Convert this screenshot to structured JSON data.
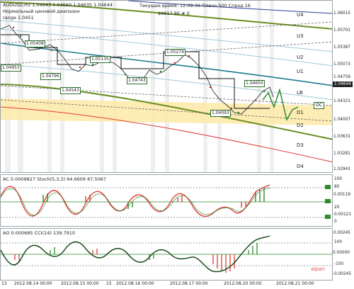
{
  "main": {
    "symbol_info": "AUDUSD,H1  1.04643 1.04660 1.04635 1.04644",
    "range_label": "Нормальный ценовой диапазон",
    "range_sub": "range 1.0451",
    "server_time": "Текущее время: 12:09:36 Плечо 500 Спрэд 16",
    "balance": "$9617.86   # 0",
    "levels": [
      "U4",
      "U3",
      "U2",
      "U1",
      "LB",
      "D1",
      "D2",
      "D3",
      "D4"
    ],
    "price_labels": [
      "1.05408",
      "1.04953",
      "1.04796",
      "1.05135",
      "1.04543",
      "1.04743",
      "1.05274",
      "1.04650",
      "1.04093"
    ],
    "oc_tag": "OC",
    "price_ticks": [
      "1.06015",
      "1.05701",
      "1.05387",
      "1.05073",
      "1.04759",
      "1.04644",
      "1.04321",
      "1.04007",
      "1.03631",
      "1.03281",
      "1.02941"
    ],
    "current_price": "1.04644"
  },
  "ac_panel": {
    "title": "AC 0.0009827  Stoch(5,3,3) 94.6609 87.5067",
    "ticks": [
      "100",
      "80",
      "0.00119",
      "20",
      "-0.00121",
      "0"
    ]
  },
  "cci_panel": {
    "title": "AO 0.000685  CCI(14) 139.7910",
    "ticks": [
      "0.00245",
      "100",
      "0.00000",
      "-100",
      "-0.00245"
    ],
    "watermark": "alpari"
  },
  "x_axis": {
    "labels": [
      "13",
      "2012.08.14 00:00",
      "2012.08.15 00:00",
      "15",
      "2012.08.16 00:00",
      "2012.08.17 00:00",
      "2012.08.20 00:00",
      "2012.08.21 00:00"
    ]
  },
  "colors": {
    "grid": "#dfe5e9",
    "band": "#fde9a6",
    "ma_green": "#6b8e23",
    "ma_teal": "#1e7b8a",
    "ma_red": "#e23b3b",
    "ma_blue": "#2c3c9a",
    "candle_up": "#1f7a1f",
    "candle_down": "#d02020"
  }
}
